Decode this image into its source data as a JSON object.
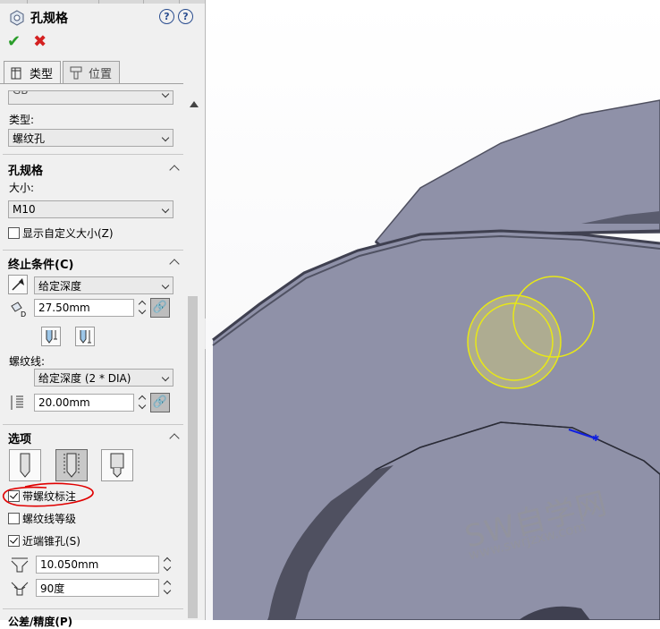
{
  "panel": {
    "title": "孔规格",
    "tabs": [
      {
        "label": "类型"
      },
      {
        "label": "位置"
      }
    ],
    "standard_partial": "GB",
    "type_label": "类型:",
    "type_value": "螺纹孔",
    "hole_spec": {
      "heading": "孔规格",
      "size_label": "大小:",
      "size_value": "M10",
      "custom_size_label": "显示自定义大小(Z)",
      "custom_size_checked": false
    },
    "end_condition": {
      "heading": "终止条件(C)",
      "condition_value": "给定深度",
      "depth_value": "27.50mm",
      "thread_label": "螺纹线:",
      "thread_condition": "给定深度 (2 * DIA)",
      "thread_depth": "20.00mm"
    },
    "options": {
      "heading": "选项",
      "cosmetic_thread_label": "带螺纹标注",
      "cosmetic_thread_checked": true,
      "thread_class_label": "螺纹线等级",
      "thread_class_checked": false,
      "near_countersink_label": "近端锥孔(S)",
      "near_countersink_checked": true,
      "countersink_diameter": "10.050mm",
      "countersink_angle": "90度"
    },
    "tolerance_heading_partial": "公差/精度(P)"
  },
  "watermark": {
    "brand": "SW自学网",
    "url": "www.swrjzxw.com"
  },
  "colors": {
    "panel_bg": "#f0f0f0",
    "model_face": "#8f91a8",
    "model_dark": "#4f5060",
    "highlight": "#e8e816",
    "annotation_red": "#e00000"
  }
}
